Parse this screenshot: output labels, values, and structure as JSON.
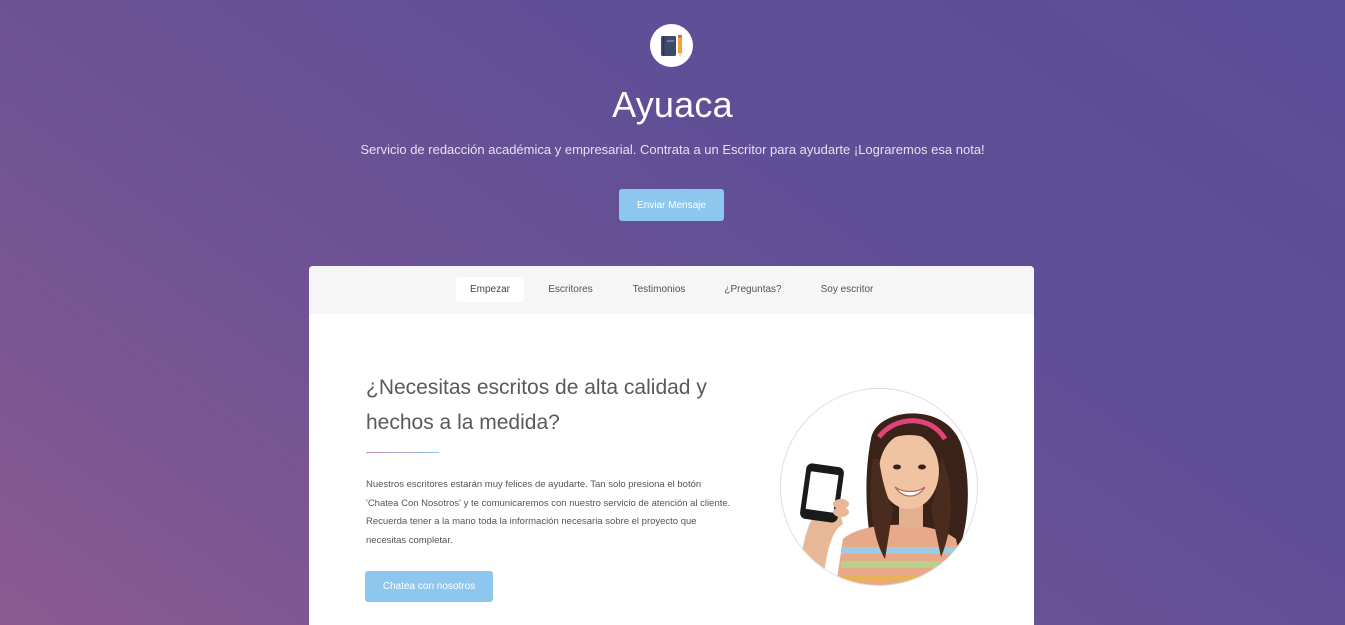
{
  "header": {
    "logo_icon": "notebook-pencil-icon",
    "title": "Ayuaca",
    "tagline": "Servicio de redacción académica y empresarial. Contrata a un Escritor para ayudarte  ¡Lograremos esa nota!",
    "cta_label": "Enviar Mensaje"
  },
  "nav": {
    "items": [
      {
        "label": "Empezar",
        "active": true
      },
      {
        "label": "Escritores",
        "active": false
      },
      {
        "label": "Testimonios",
        "active": false
      },
      {
        "label": "¿Preguntas?",
        "active": false
      },
      {
        "label": "Soy escritor",
        "active": false
      }
    ]
  },
  "intro": {
    "title": "¿Necesitas escritos de alta calidad y hechos a la medida?",
    "body": "Nuestros escritores estarán muy felices de ayudarte. Tan solo presiona el botón 'Chatea Con Nosotros' y te comunicaremos con nuestro servicio de atención al cliente. Recuerda tener a la mano toda la información necesaria sobre el proyecto que necesitas completar.",
    "cta_label": "Chatea con nosotros",
    "image_icon": "girl-holding-phone-image"
  },
  "colors": {
    "accent": "#8ec7ee",
    "background_start": "#8a5a90",
    "background_end": "#5a4d97"
  }
}
